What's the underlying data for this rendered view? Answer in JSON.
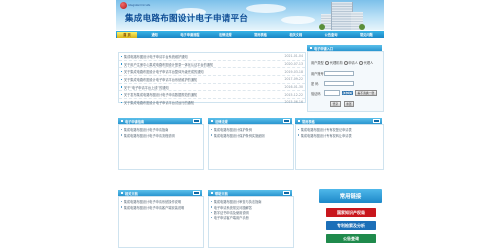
{
  "header": {
    "logo_text": "Integrated Circuits",
    "site_title": "集成电路布图设计电子申请平台"
  },
  "nav": {
    "items": [
      "首 页",
      "通知",
      "电子申请流程",
      "法律法规",
      "常用表格",
      "相关文档",
      "公告查询",
      "常见问题"
    ]
  },
  "news": {
    "items": [
      {
        "title": "集成电路布图设计电子申请平台系统维护通知",
        "date": "2021-01-04"
      },
      {
        "title": "关于用户注册中心集成电路布图设计登录一体化认证平台的通知",
        "date": "2020-07-13"
      },
      {
        "title": "关于集成电路布图设计电子申请平台整体升级完成的通知",
        "date": "2019-03-18"
      },
      {
        "title": "关于集成电路布图设计电子申请平台系统维护的通知",
        "date": "2017-09-22"
      },
      {
        "title": "关于“电子申请平台上线”的通知",
        "date": "2016-01-30"
      },
      {
        "title": "关于发布集成电路布图设计电子申请数据规范的通知",
        "date": "2015-12-22"
      },
      {
        "title": "关于集成电路布图设计电子申请平台试运行的通知",
        "date": "2015-06-16"
      }
    ]
  },
  "login": {
    "title": "电子申请入口",
    "type_label": "用户类型",
    "radios": [
      "代理机构",
      "申请人",
      "代理人"
    ],
    "account_label": "用户账号",
    "password_label": "密 码",
    "code_label": "验证码",
    "captcha": "X7KD",
    "refresh_label": "看不清换一张",
    "login_label": "登录",
    "reset_label": "重置"
  },
  "panels_mid": [
    {
      "title": "电子申请指南",
      "items": [
        "集成电路布图设计电子申请指南",
        "集成电路布图设计电子申请流程说明"
      ]
    },
    {
      "title": "法律法规",
      "items": [
        "集成电路布图设计保护条例",
        "集成电路布图设计保护条例实施细则"
      ]
    },
    {
      "title": "常用表格",
      "items": [
        "集成电路布图设计专有权登记申请表",
        "集成电路布图设计专有权转让申请表"
      ]
    }
  ],
  "panels_low": [
    {
      "title": "相关文档",
      "items": [
        "集成电路布图设计电子申请系统操作说明",
        "集成电路布图设计电子申请客户端安装说明"
      ]
    },
    {
      "title": "帮助文档",
      "items": [
        "集成电路布图设计审查与执法指南",
        "电子申请系统常见问题解答",
        "数字证书申请及使用说明",
        "电子申请客户端用户手册"
      ]
    }
  ],
  "links": {
    "title": "常用链接",
    "items": [
      {
        "label": "国家知识产权局",
        "color": "#c8161d"
      },
      {
        "label": "专利检索及分析",
        "color": "#1c6fb8"
      },
      {
        "label": "公告查询",
        "color": "#1f8a4c"
      }
    ]
  }
}
